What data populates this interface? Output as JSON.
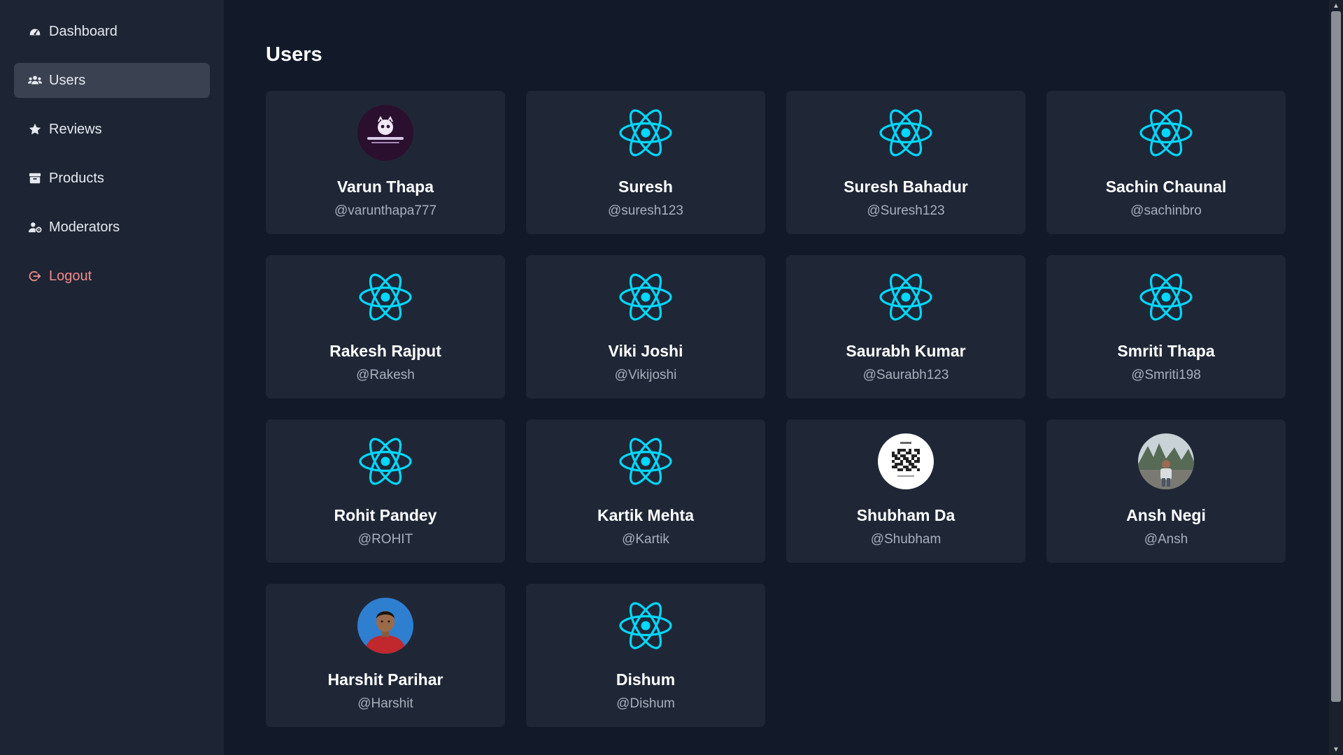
{
  "sidebar": {
    "items": [
      {
        "label": "Dashboard",
        "icon": "dashboard-gauge-icon"
      },
      {
        "label": "Users",
        "icon": "users-icon",
        "active": true
      },
      {
        "label": "Reviews",
        "icon": "star-icon"
      },
      {
        "label": "Products",
        "icon": "box-icon"
      },
      {
        "label": "Moderators",
        "icon": "user-cog-icon"
      },
      {
        "label": "Logout",
        "icon": "logout-icon"
      }
    ]
  },
  "main": {
    "title": "Users",
    "users": [
      {
        "name": "Varun Thapa",
        "handle": "@varunthapa777",
        "avatar": "wannabe-coder-logo"
      },
      {
        "name": "Suresh",
        "handle": "@suresh123",
        "avatar": "react-logo"
      },
      {
        "name": "Suresh Bahadur",
        "handle": "@Suresh123",
        "avatar": "react-logo"
      },
      {
        "name": "Sachin Chaunal",
        "handle": "@sachinbro",
        "avatar": "react-logo"
      },
      {
        "name": "Rakesh Rajput",
        "handle": "@Rakesh",
        "avatar": "react-logo"
      },
      {
        "name": "Viki Joshi",
        "handle": "@Vikijoshi",
        "avatar": "react-logo"
      },
      {
        "name": "Saurabh Kumar",
        "handle": "@Saurabh123",
        "avatar": "react-logo"
      },
      {
        "name": "Smriti Thapa",
        "handle": "@Smriti198",
        "avatar": "react-logo"
      },
      {
        "name": "Rohit Pandey",
        "handle": "@ROHIT",
        "avatar": "react-logo"
      },
      {
        "name": "Kartik Mehta",
        "handle": "@Kartik",
        "avatar": "react-logo"
      },
      {
        "name": "Shubham Da",
        "handle": "@Shubham",
        "avatar": "qr-code-photo"
      },
      {
        "name": "Ansh Negi",
        "handle": "@Ansh",
        "avatar": "outdoor-photo"
      },
      {
        "name": "Harshit Parihar",
        "handle": "@Harshit",
        "avatar": "child-portrait-photo"
      },
      {
        "name": "Dishum",
        "handle": "@Dishum",
        "avatar": "react-logo"
      }
    ]
  },
  "colors": {
    "background": "#121a2a",
    "sidebar": "#1d2534",
    "card": "#1f2737",
    "active_item": "#3a4252",
    "react_cyan": "#00d8ff",
    "logout": "#f28b8b"
  }
}
